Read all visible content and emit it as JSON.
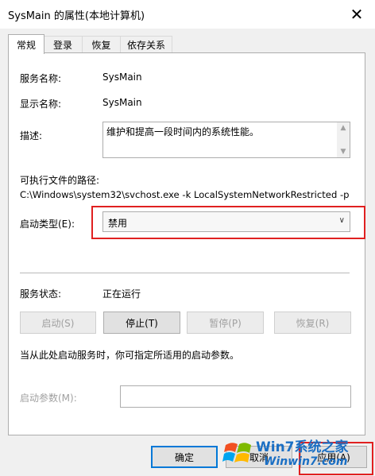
{
  "window": {
    "title": "SysMain 的属性(本地计算机)",
    "close_glyph": "✕"
  },
  "tabs": [
    {
      "label": "常规",
      "active": true
    },
    {
      "label": "登录",
      "active": false
    },
    {
      "label": "恢复",
      "active": false
    },
    {
      "label": "依存关系",
      "active": false
    }
  ],
  "general": {
    "service_name_label": "服务名称:",
    "service_name": "SysMain",
    "display_name_label": "显示名称:",
    "display_name": "SysMain",
    "description_label": "描述:",
    "description": "维护和提高一段时间内的系统性能。",
    "exe_path_label": "可执行文件的路径:",
    "exe_path": "C:\\Windows\\system32\\svchost.exe -k LocalSystemNetworkRestricted -p",
    "startup_type_label": "启动类型(E):",
    "startup_type_value": "禁用",
    "status_label": "服务状态:",
    "status_value": "正在运行",
    "buttons": {
      "start": "启动(S)",
      "stop": "停止(T)",
      "pause": "暂停(P)",
      "resume": "恢复(R)"
    },
    "hint": "当从此处启动服务时，你可指定所适用的启动参数。",
    "start_params_label": "启动参数(M):",
    "start_params_value": ""
  },
  "footer": {
    "ok": "确定",
    "cancel": "取消",
    "apply": "应用(A)"
  },
  "watermark": {
    "brand": "Win7系统之家",
    "url": "Winwin7.com"
  },
  "colors": {
    "highlight": "#e02020",
    "focus": "#0078d7",
    "watermark": "#1a6fc4"
  }
}
